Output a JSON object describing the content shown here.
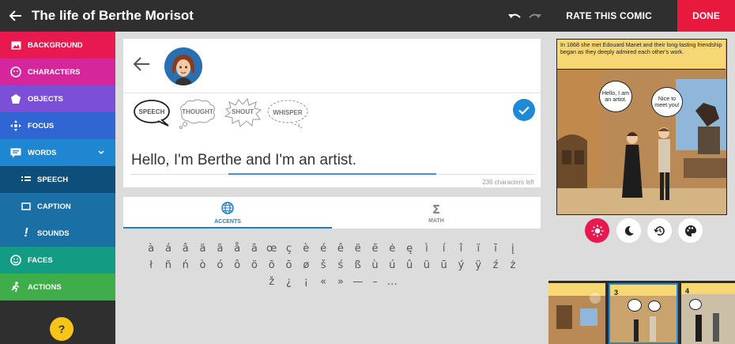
{
  "header": {
    "title": "The life of Berthe Morisot",
    "rate_label": "RATE THIS COMIC",
    "done_label": "DONE"
  },
  "sidebar": {
    "items": [
      {
        "label": "BACKGROUND",
        "color": "#e8194f"
      },
      {
        "label": "CHARACTERS",
        "color": "#d6269b"
      },
      {
        "label": "OBJECTS",
        "color": "#7b4fd6"
      },
      {
        "label": "FOCUS",
        "color": "#2f66d3"
      },
      {
        "label": "WORDS",
        "color": "#1f86d1"
      }
    ],
    "sub_items": [
      {
        "label": "SPEECH"
      },
      {
        "label": "CAPTION"
      },
      {
        "label": "SOUNDS"
      }
    ],
    "items_after": [
      {
        "label": "FACES",
        "color": "#139b84"
      },
      {
        "label": "ACTIONS",
        "color": "#3fae4a"
      }
    ],
    "help_label": "?"
  },
  "editor": {
    "bubble_types": [
      "SPEECH",
      "THOUGHT",
      "SHOUT",
      "WHISPER"
    ],
    "text_value": "Hello, I'm Berthe and I'm an artist.",
    "chars_left": "236 characters left",
    "tabs": [
      {
        "label": "ACCENTS",
        "icon": "globe-icon"
      },
      {
        "label": "MATH",
        "icon": "sigma-icon"
      }
    ],
    "accent_rows": [
      [
        "à",
        "á",
        "â",
        "ä",
        "ã",
        "å",
        "ā",
        "œ",
        "ç",
        "è",
        "é",
        "ê",
        "ë",
        "ē",
        "ė",
        "ę",
        "ì",
        "í",
        "î",
        "ï",
        "ī",
        "į"
      ],
      [
        "ł",
        "ñ",
        "ń",
        "ò",
        "ó",
        "ô",
        "ö",
        "õ",
        "ō",
        "ø",
        "š",
        "ś",
        "ß",
        "ù",
        "ú",
        "û",
        "ü",
        "ū",
        "ý",
        "ÿ",
        "ź",
        "ż"
      ],
      [
        "ž",
        "¿",
        "¡",
        "«",
        "»",
        "—",
        "–",
        "…"
      ]
    ]
  },
  "preview": {
    "caption": "In 1868 she met Edouard Manet and their long-lasting friendship began as they deeply admired each other's work.",
    "bubble_left": "Hello, I am an artist.",
    "bubble_right": "Nice to meet you!",
    "thumb_numbers": [
      "3",
      "4"
    ]
  },
  "colors": {
    "accent": "#1e8ad6",
    "done": "#e8193c",
    "help": "#f5c518"
  }
}
